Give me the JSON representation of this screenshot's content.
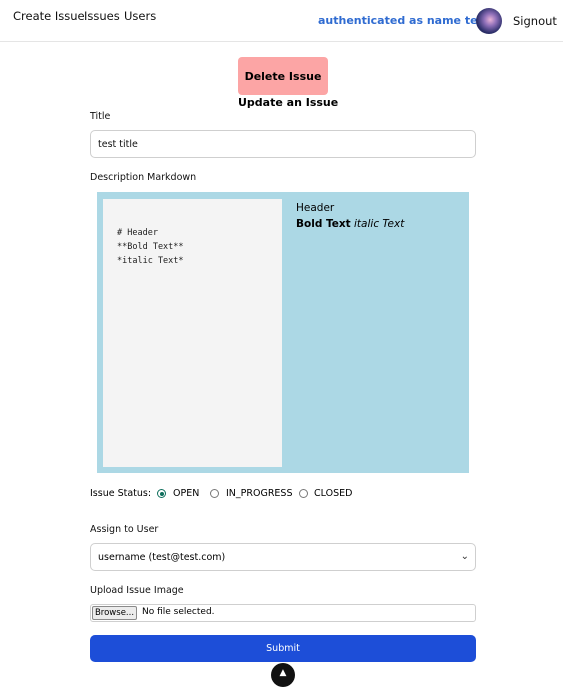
{
  "nav": {
    "links": [
      "Create Issue",
      "Issues",
      "Users"
    ],
    "auth_text": "authenticated as name test",
    "signout": "Signout"
  },
  "delete_button": "Delete Issue",
  "page_title": "Update an Issue",
  "form": {
    "title_label": "Title",
    "title_value": "test title",
    "description_label": "Description Markdown",
    "markdown_source": "# Header\n**Bold Text**\n*italic Text*",
    "preview": {
      "header": "Header",
      "bold": "Bold Text",
      "italic": "italic Text"
    },
    "status_label": "Issue Status:",
    "status_options": [
      "OPEN",
      "IN_PROGRESS",
      "CLOSED"
    ],
    "status_selected": "OPEN",
    "assign_label": "Assign to User",
    "assign_value": "username (test@test.com)",
    "upload_label": "Upload Issue Image",
    "browse_label": "Browse...",
    "file_status": "No file selected.",
    "submit_label": "Submit"
  },
  "icons": {
    "avatar": "user-avatar",
    "select_chevron": "chevron-down-icon",
    "fab": "triangle-logo-icon"
  },
  "colors": {
    "auth_text": "#2f6bd1",
    "delete_bg": "#fca5a5",
    "markdown_bg": "#acd8e5",
    "submit_bg": "#1d4ed8",
    "radio_accent": "#0e6e5c"
  }
}
